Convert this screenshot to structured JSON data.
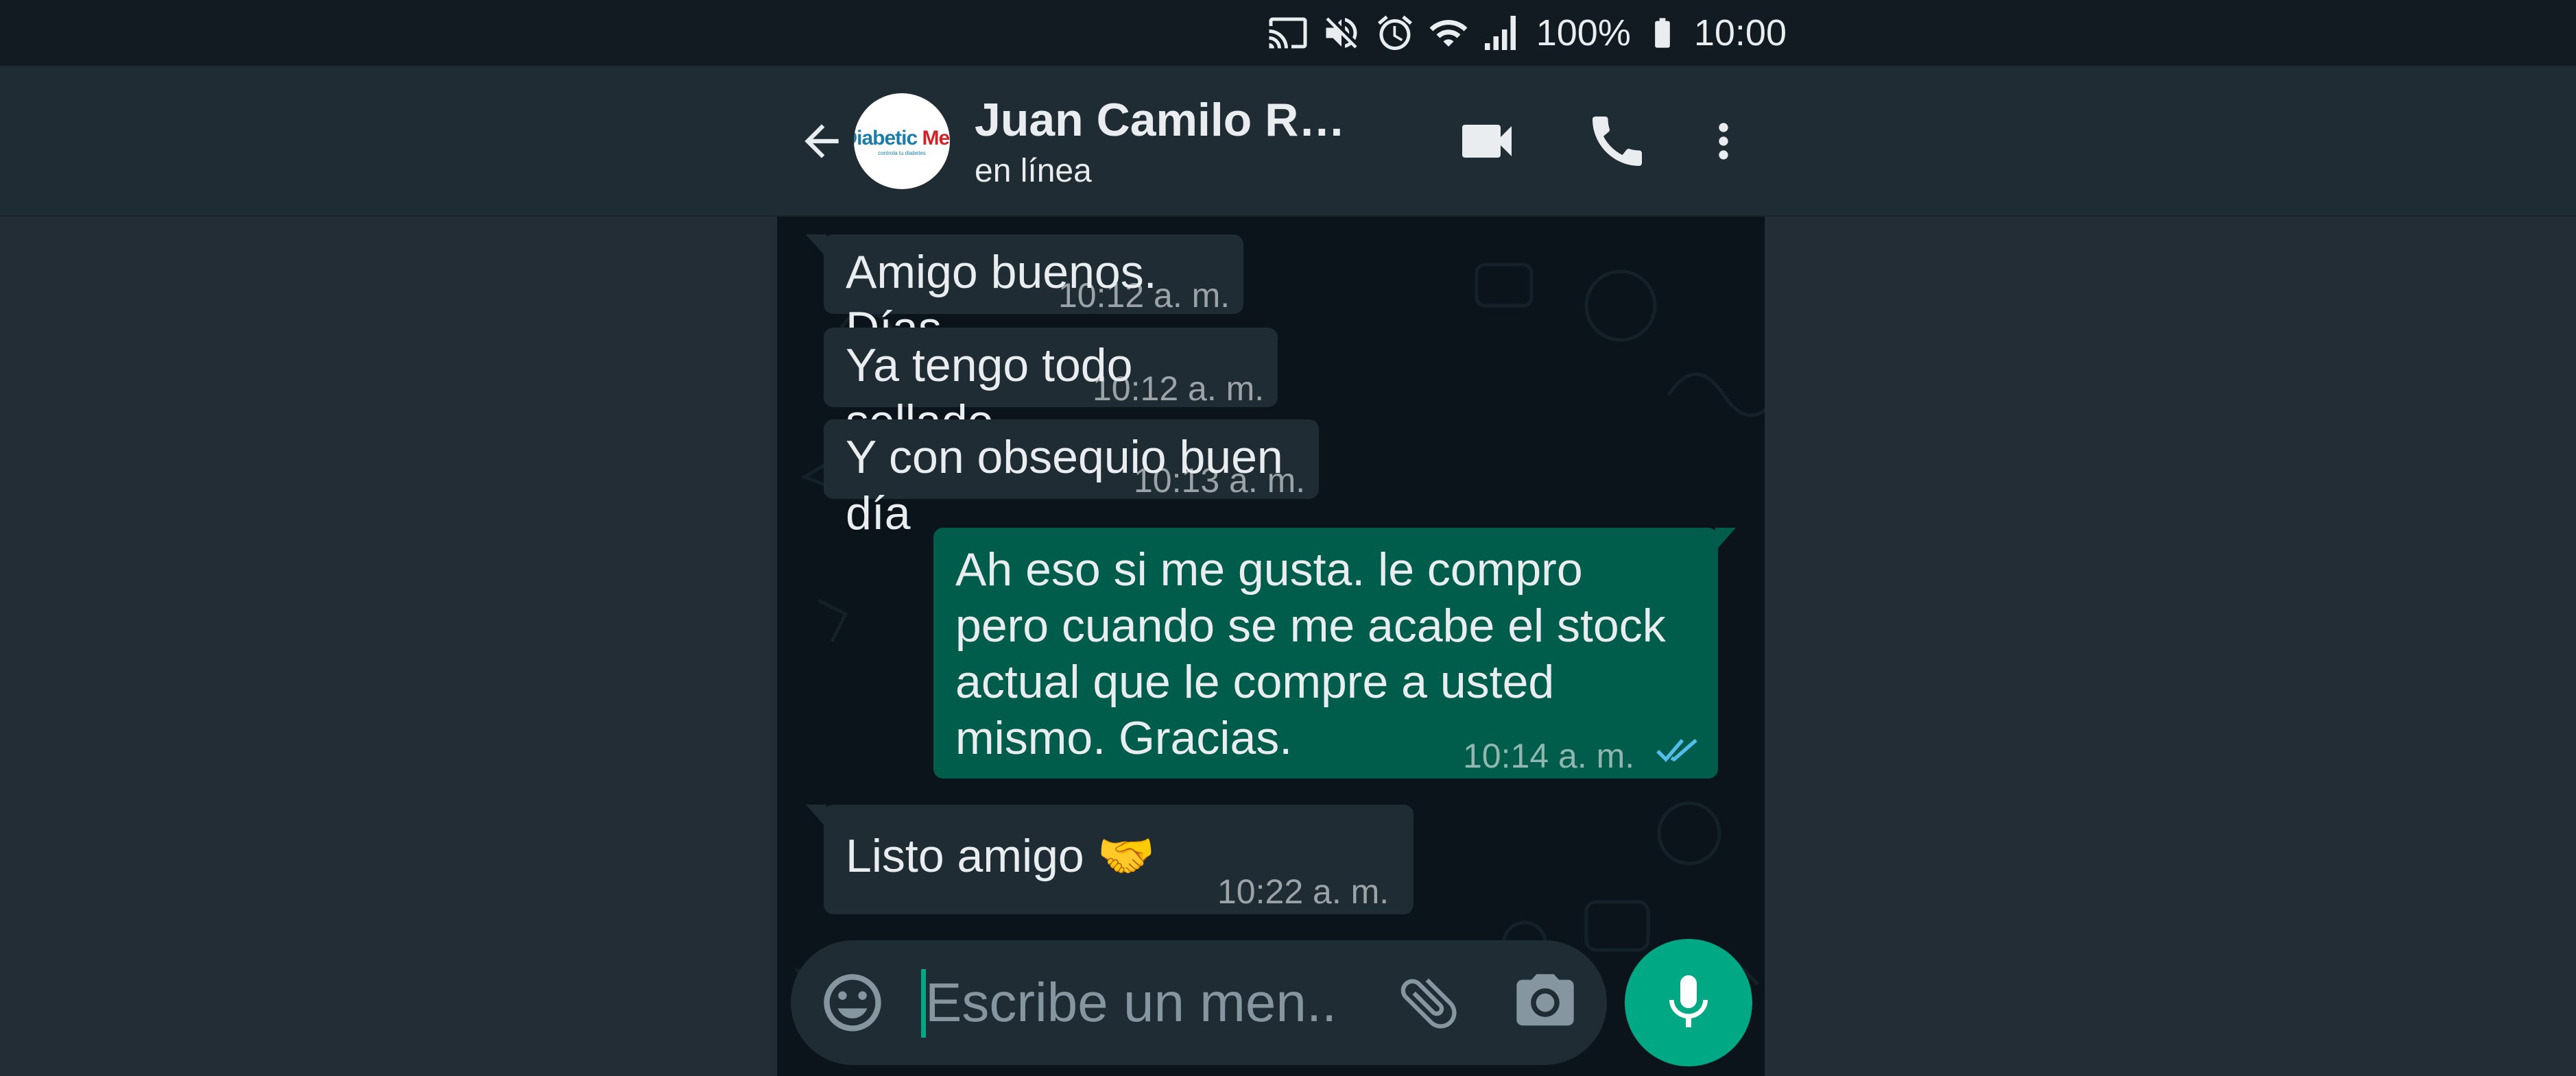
{
  "status_bar": {
    "battery": "100%",
    "time": "10:00",
    "icons": [
      "cast-icon",
      "mute-icon",
      "alarm-icon",
      "wifi-icon",
      "signal-icon",
      "battery-icon"
    ]
  },
  "header": {
    "contact_name": "Juan Camilo Ra...",
    "status": "en línea",
    "avatar_logo": "Diabetic Med",
    "avatar_subtitle": "controla tu diabetes",
    "actions": [
      "video-call-icon",
      "voice-call-icon",
      "more-options-icon"
    ]
  },
  "messages": [
    {
      "direction": "in",
      "text": "Amigo buenos. Días",
      "time": "10:12 a. m."
    },
    {
      "direction": "in",
      "text": "Ya tengo todo sellado",
      "time": "10:12 a. m."
    },
    {
      "direction": "in",
      "text": "Y con obsequio buen día",
      "time": "10:13 a. m."
    },
    {
      "direction": "out",
      "lines": [
        "Ah eso si me gusta. le compro",
        "pero cuando se me acabe el stock",
        "actual que le compre a usted",
        "mismo. Gracias."
      ],
      "time": "10:14 a. m.",
      "read": true
    },
    {
      "direction": "in",
      "text": "Listo amigo 🤝",
      "time": "10:22 a. m."
    }
  ],
  "composer": {
    "placeholder": "Escribe un men..."
  },
  "colors": {
    "accent": "#00a884",
    "outgoing_bubble": "#005c4b",
    "incoming_bubble": "#202c33",
    "read_ticks": "#53bdeb"
  }
}
